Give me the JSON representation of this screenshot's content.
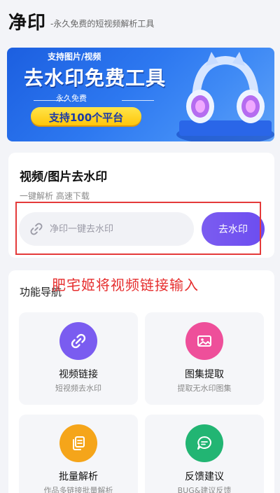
{
  "header": {
    "title": "净印",
    "subtitle": "-永久免费的短视频解析工具"
  },
  "banner": {
    "top_text": "支持图片/视频",
    "main_text": "去水印免费工具",
    "free_text": "永久免费",
    "badge_text": "支持100个平台",
    "dots": 3,
    "active_dot": 0
  },
  "remove_card": {
    "title": "视频/图片去水印",
    "subtitle": "一键解析 高速下载",
    "input_placeholder": "净印一键去水印",
    "input_value": "",
    "button_label": "去水印"
  },
  "annotation": "肥宅姬将视频链接输入",
  "nav": {
    "title": "功能导航",
    "items": [
      {
        "name": "视频链接",
        "desc": "短视频去水印",
        "icon": "link-icon",
        "color": "#7a5cf0"
      },
      {
        "name": "图集提取",
        "desc": "提取无水印图集",
        "icon": "image-icon",
        "color": "#ee4f9a"
      },
      {
        "name": "批量解析",
        "desc": "作品多链接批量解析",
        "icon": "copy-icon",
        "color": "#f5a51a"
      },
      {
        "name": "反馈建议",
        "desc": "BUG&建议反馈",
        "icon": "chat-icon",
        "color": "#22b573"
      }
    ]
  }
}
